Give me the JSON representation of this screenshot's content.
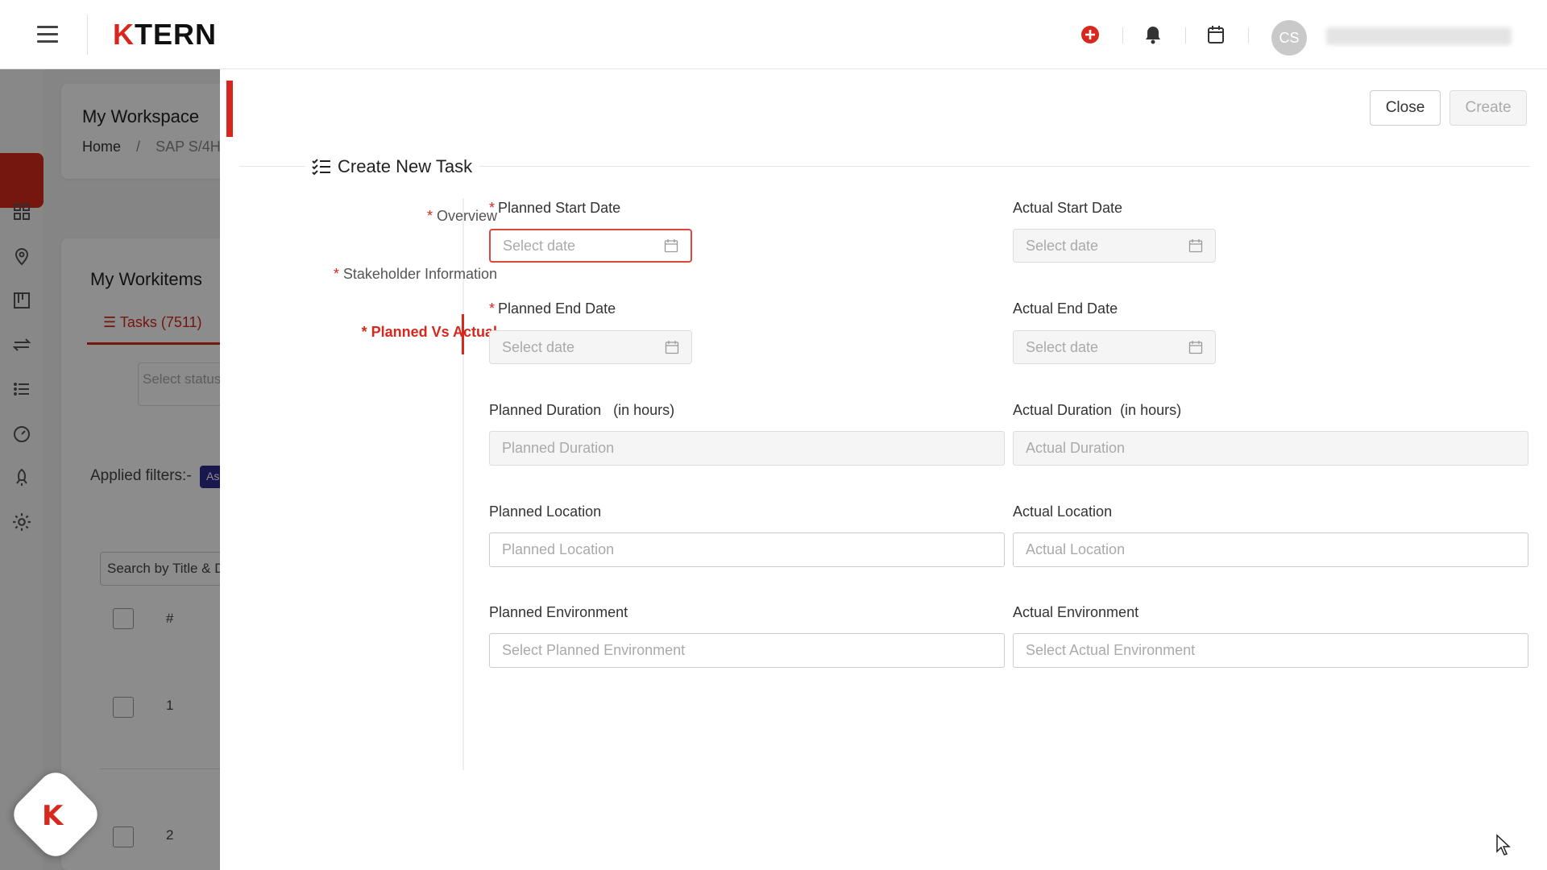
{
  "topbar": {
    "logo_k": "K",
    "logo_rest": "TERN",
    "avatar_initials": "CS",
    "colors": {
      "brand": "#d6281c"
    },
    "icons": [
      "hamburger-icon",
      "add-circle-icon",
      "bell-icon",
      "calendar-icon"
    ]
  },
  "workspace": {
    "title": "My Workspace",
    "breadcrumb": {
      "home": "Home",
      "sep": "/",
      "current": "SAP S/4H."
    },
    "workitems_title": "My Workitems",
    "tasks_tab": "Tasks (7511)",
    "status_placeholder": "Select status",
    "applied_filters": "Applied filters:-",
    "filter_badge": "As",
    "search_placeholder": "Search by Title & D",
    "table_header_num": "#",
    "rows": [
      "1",
      "2"
    ]
  },
  "drawer": {
    "close_label": "Close",
    "create_label": "Create",
    "title": "Create New Task",
    "nav": [
      {
        "label": "Overview",
        "required": "*"
      },
      {
        "label": "Stakeholder Information",
        "required": "*"
      },
      {
        "label": "Planned Vs Actual",
        "required": "*"
      }
    ],
    "fields": {
      "planned_start_label": "Planned Start Date",
      "planned_start_placeholder": "Select date",
      "actual_start_label": "Actual Start Date",
      "actual_start_placeholder": "Select date",
      "planned_end_label": "Planned End Date",
      "planned_end_placeholder": "Select date",
      "actual_end_label": "Actual End Date",
      "actual_end_placeholder": "Select date",
      "planned_duration_label": "Planned Duration   (in hours)",
      "planned_duration_placeholder": "Planned Duration",
      "actual_duration_label": "Actual Duration  (in hours)",
      "actual_duration_placeholder": "Actual Duration",
      "planned_location_label": "Planned Location",
      "planned_location_placeholder": "Planned Location",
      "actual_location_label": "Actual Location",
      "actual_location_placeholder": "Actual Location",
      "planned_env_label": "Planned Environment",
      "planned_env_placeholder": "Select Planned Environment",
      "actual_env_label": "Actual Environment",
      "actual_env_placeholder": "Select Actual Environment"
    },
    "required_mark": "*"
  }
}
